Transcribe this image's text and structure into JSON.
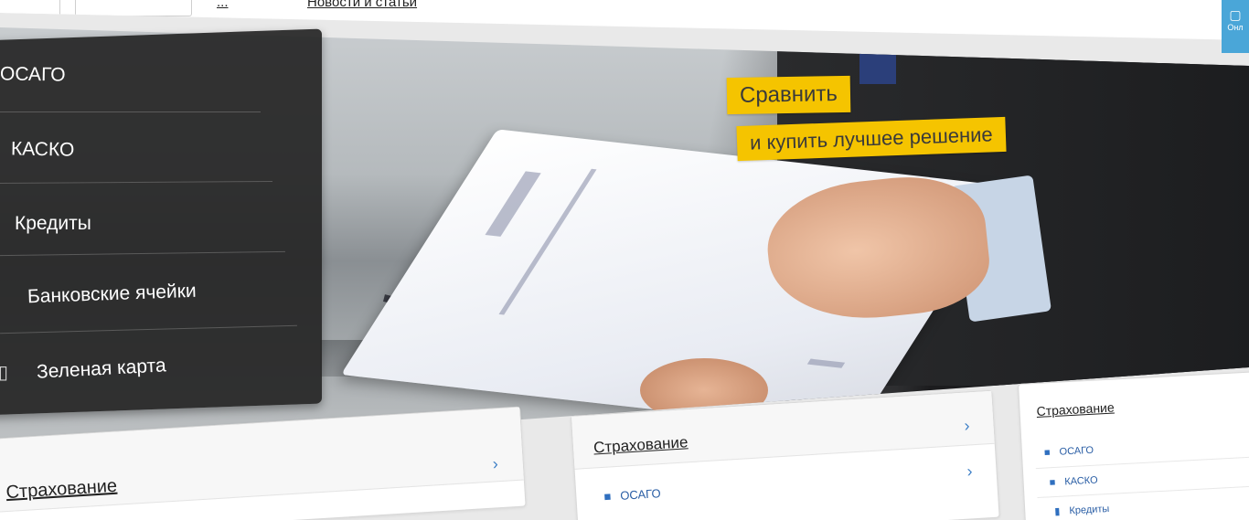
{
  "header": {
    "nav_link_1": "...",
    "nav_link_2": "Новости и статьи",
    "badge_text": "Онл"
  },
  "hero": {
    "tag_line_1": "Сравнить",
    "tag_line_2": "и купить лучшее решение"
  },
  "side_menu": {
    "items": [
      {
        "label": "ОСАГО"
      },
      {
        "label": "КАСКО"
      },
      {
        "label": "Кредиты"
      },
      {
        "label": "Банковские ячейки"
      },
      {
        "label": "Зеленая карта"
      }
    ]
  },
  "cards": [
    {
      "title": "Страхование",
      "rows": []
    },
    {
      "title": "Страхование",
      "rows": [
        {
          "label": "ОСАГО",
          "icon": "car-icon"
        }
      ]
    },
    {
      "title": "Страхование",
      "rows": [
        {
          "label": "ОСАГО",
          "icon": "car-icon"
        },
        {
          "label": "КАСКО",
          "icon": "car-icon"
        },
        {
          "label": "Кредиты",
          "icon": "document-icon"
        }
      ]
    }
  ],
  "colors": {
    "accent_yellow": "#f5c400",
    "menu_bg": "#262626",
    "link_blue": "#2a5ea5",
    "badge_blue": "#4aa6d8"
  }
}
